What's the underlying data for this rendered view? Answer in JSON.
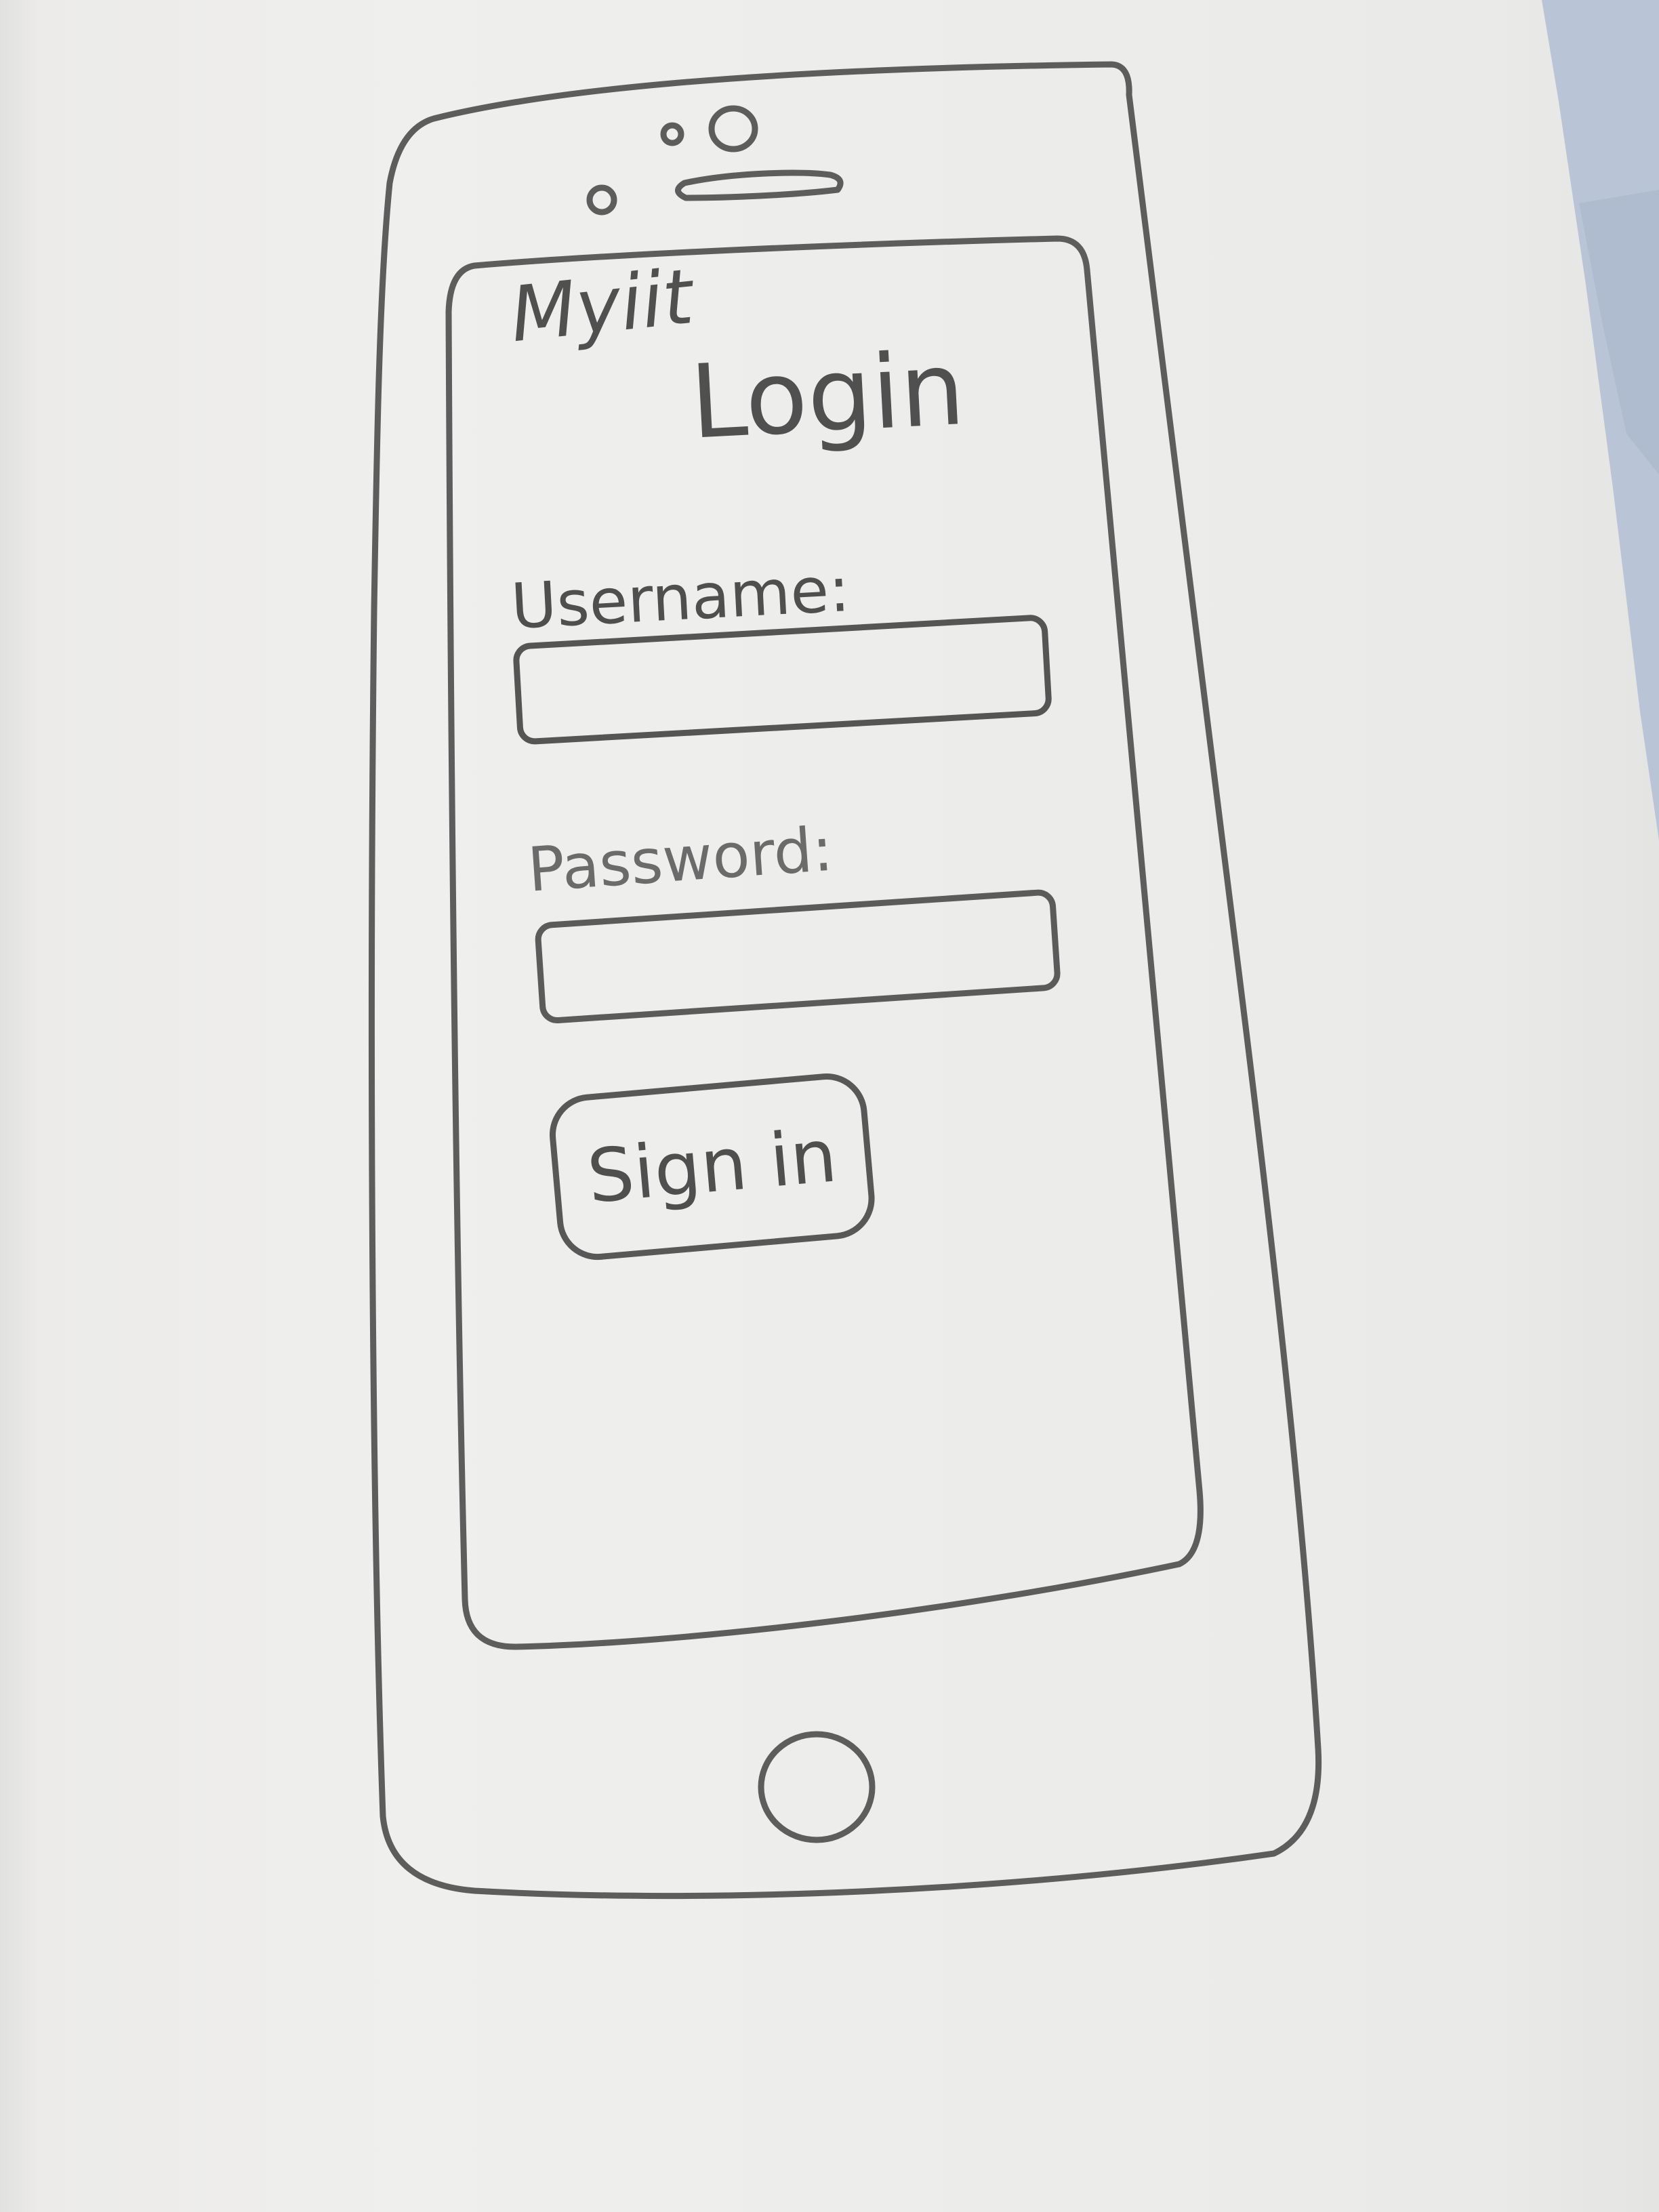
{
  "app": {
    "name": "Myiit"
  },
  "header": {
    "title": "Login"
  },
  "form": {
    "username_label": "Username:",
    "username_value": "",
    "password_label": "Password:",
    "password_value": "",
    "signin_label": "Sign in"
  },
  "icons": {
    "front_camera": "camera-icon",
    "speaker": "speaker-icon",
    "sensor": "sensor-icon",
    "home_button": "home-button-icon"
  },
  "colors": {
    "pencil": "#5d5d5d",
    "paper": "#efefed",
    "cloth": "#b9c5d6"
  }
}
